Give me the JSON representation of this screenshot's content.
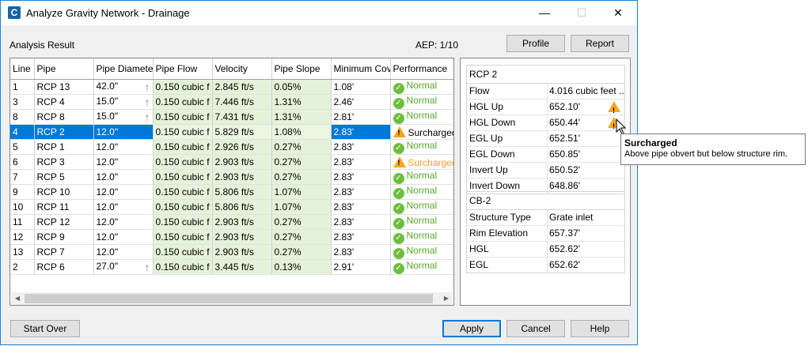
{
  "window": {
    "title": "Analyze Gravity Network - Drainage",
    "app_icon_glyph": "C",
    "controls": {
      "minimize": "—",
      "maximize": "☐",
      "close": "✕"
    }
  },
  "analysis_label": "Analysis Result",
  "aep_label": "AEP: 1/10",
  "buttons": {
    "profile": "Profile",
    "report": "Report",
    "start_over": "Start Over",
    "apply": "Apply",
    "cancel": "Cancel",
    "help": "Help"
  },
  "grid": {
    "columns": [
      "Line",
      "Pipe",
      "Pipe Diameter",
      "Pipe Flow",
      "Velocity",
      "Pipe Slope",
      "Minimum Cover",
      "Performance"
    ],
    "selected_row_index": 3,
    "rows": [
      {
        "line": "1",
        "pipe": "RCP 13",
        "diameter": "42.0\"",
        "arrow": true,
        "flow": "0.150 cubic f",
        "velocity": "2.845 ft/s",
        "slope": "0.05%",
        "cover": "1.08'",
        "perf": "Normal",
        "status": "ok"
      },
      {
        "line": "3",
        "pipe": "RCP 4",
        "diameter": "15.0\"",
        "arrow": true,
        "flow": "0.150 cubic f",
        "velocity": "7.446 ft/s",
        "slope": "1.31%",
        "cover": "2.46'",
        "perf": "Normal",
        "status": "ok"
      },
      {
        "line": "8",
        "pipe": "RCP 8",
        "diameter": "15.0\"",
        "arrow": true,
        "flow": "0.150 cubic f",
        "velocity": "7.431 ft/s",
        "slope": "1.31%",
        "cover": "2.81'",
        "perf": "Normal",
        "status": "ok"
      },
      {
        "line": "4",
        "pipe": "RCP 2",
        "diameter": "12.0\"",
        "arrow": false,
        "flow": "0.150 cubic f",
        "velocity": "5.829 ft/s",
        "slope": "1.08%",
        "cover": "2.83'",
        "perf": "Surcharged",
        "status": "warn"
      },
      {
        "line": "5",
        "pipe": "RCP 1",
        "diameter": "12.0\"",
        "arrow": false,
        "flow": "0.150 cubic f",
        "velocity": "2.926 ft/s",
        "slope": "0.27%",
        "cover": "2.83'",
        "perf": "Normal",
        "status": "ok"
      },
      {
        "line": "6",
        "pipe": "RCP 3",
        "diameter": "12.0\"",
        "arrow": false,
        "flow": "0.150 cubic f",
        "velocity": "2.903 ft/s",
        "slope": "0.27%",
        "cover": "2.83'",
        "perf": "Surcharged",
        "status": "warn"
      },
      {
        "line": "7",
        "pipe": "RCP 5",
        "diameter": "12.0\"",
        "arrow": false,
        "flow": "0.150 cubic f",
        "velocity": "2.903 ft/s",
        "slope": "0.27%",
        "cover": "2.83'",
        "perf": "Normal",
        "status": "ok"
      },
      {
        "line": "9",
        "pipe": "RCP 10",
        "diameter": "12.0\"",
        "arrow": false,
        "flow": "0.150 cubic f",
        "velocity": "5.806 ft/s",
        "slope": "1.07%",
        "cover": "2.83'",
        "perf": "Normal",
        "status": "ok"
      },
      {
        "line": "10",
        "pipe": "RCP 11",
        "diameter": "12.0\"",
        "arrow": false,
        "flow": "0.150 cubic f",
        "velocity": "5.806 ft/s",
        "slope": "1.07%",
        "cover": "2.83'",
        "perf": "Normal",
        "status": "ok"
      },
      {
        "line": "11",
        "pipe": "RCP 12",
        "diameter": "12.0\"",
        "arrow": false,
        "flow": "0.150 cubic f",
        "velocity": "2.903 ft/s",
        "slope": "0.27%",
        "cover": "2.83'",
        "perf": "Normal",
        "status": "ok"
      },
      {
        "line": "12",
        "pipe": "RCP 9",
        "diameter": "12.0\"",
        "arrow": false,
        "flow": "0.150 cubic f",
        "velocity": "2.903 ft/s",
        "slope": "0.27%",
        "cover": "2.83'",
        "perf": "Normal",
        "status": "ok"
      },
      {
        "line": "13",
        "pipe": "RCP 7",
        "diameter": "12.0\"",
        "arrow": false,
        "flow": "0.150 cubic f",
        "velocity": "2.903 ft/s",
        "slope": "0.27%",
        "cover": "2.83'",
        "perf": "Normal",
        "status": "ok"
      },
      {
        "line": "2",
        "pipe": "RCP 6",
        "diameter": "27.0\"",
        "arrow": true,
        "flow": "0.150 cubic f",
        "velocity": "3.445 ft/s",
        "slope": "0.13%",
        "cover": "2.91'",
        "perf": "Normal",
        "status": "ok"
      }
    ]
  },
  "pipe_props": {
    "header": "RCP 2",
    "rows": [
      {
        "k": "Flow",
        "v": "4.016 cubic feet ...",
        "warn": false
      },
      {
        "k": "HGL Up",
        "v": "652.10'",
        "warn": true
      },
      {
        "k": "HGL Down",
        "v": "650.44'",
        "warn": true
      },
      {
        "k": "EGL Up",
        "v": "652.51'",
        "warn": false
      },
      {
        "k": "EGL Down",
        "v": "650.85'",
        "warn": false
      },
      {
        "k": "Invert Up",
        "v": "650.52'",
        "warn": false
      },
      {
        "k": "Invert Down",
        "v": "648.86'",
        "warn": false
      }
    ]
  },
  "structure_props": {
    "header": "CB-2",
    "rows": [
      {
        "k": "Structure Type",
        "v": "Grate inlet"
      },
      {
        "k": "Rim Elevation",
        "v": "657.37'"
      },
      {
        "k": "HGL",
        "v": "652.62'"
      },
      {
        "k": "EGL",
        "v": "652.62'"
      }
    ]
  },
  "tooltip": {
    "title": "Surcharged",
    "body": "Above pipe obvert but below structure rim."
  },
  "colors": {
    "selection": "#0078d7",
    "calc_cell": "#e4f2d9",
    "ok_green": "#6cbf3d",
    "warn_orange": "#f5a623",
    "window_border": "#1883d7"
  },
  "icons": {
    "ok": "check-circle-icon",
    "warn": "warning-triangle-icon",
    "arrow": "up-arrow-icon",
    "cursor": "mouse-pointer-icon"
  }
}
